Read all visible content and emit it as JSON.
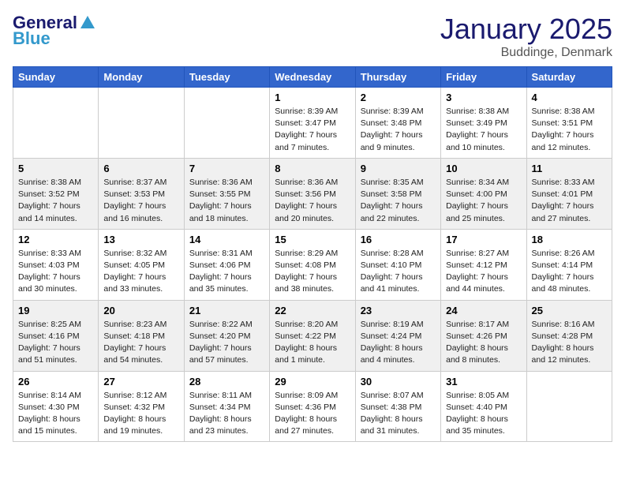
{
  "header": {
    "logo_general": "General",
    "logo_blue": "Blue",
    "month_title": "January 2025",
    "location": "Buddinge, Denmark"
  },
  "weekdays": [
    "Sunday",
    "Monday",
    "Tuesday",
    "Wednesday",
    "Thursday",
    "Friday",
    "Saturday"
  ],
  "weeks": [
    [
      {
        "day": "",
        "info": ""
      },
      {
        "day": "",
        "info": ""
      },
      {
        "day": "",
        "info": ""
      },
      {
        "day": "1",
        "info": "Sunrise: 8:39 AM\nSunset: 3:47 PM\nDaylight: 7 hours\nand 7 minutes."
      },
      {
        "day": "2",
        "info": "Sunrise: 8:39 AM\nSunset: 3:48 PM\nDaylight: 7 hours\nand 9 minutes."
      },
      {
        "day": "3",
        "info": "Sunrise: 8:38 AM\nSunset: 3:49 PM\nDaylight: 7 hours\nand 10 minutes."
      },
      {
        "day": "4",
        "info": "Sunrise: 8:38 AM\nSunset: 3:51 PM\nDaylight: 7 hours\nand 12 minutes."
      }
    ],
    [
      {
        "day": "5",
        "info": "Sunrise: 8:38 AM\nSunset: 3:52 PM\nDaylight: 7 hours\nand 14 minutes."
      },
      {
        "day": "6",
        "info": "Sunrise: 8:37 AM\nSunset: 3:53 PM\nDaylight: 7 hours\nand 16 minutes."
      },
      {
        "day": "7",
        "info": "Sunrise: 8:36 AM\nSunset: 3:55 PM\nDaylight: 7 hours\nand 18 minutes."
      },
      {
        "day": "8",
        "info": "Sunrise: 8:36 AM\nSunset: 3:56 PM\nDaylight: 7 hours\nand 20 minutes."
      },
      {
        "day": "9",
        "info": "Sunrise: 8:35 AM\nSunset: 3:58 PM\nDaylight: 7 hours\nand 22 minutes."
      },
      {
        "day": "10",
        "info": "Sunrise: 8:34 AM\nSunset: 4:00 PM\nDaylight: 7 hours\nand 25 minutes."
      },
      {
        "day": "11",
        "info": "Sunrise: 8:33 AM\nSunset: 4:01 PM\nDaylight: 7 hours\nand 27 minutes."
      }
    ],
    [
      {
        "day": "12",
        "info": "Sunrise: 8:33 AM\nSunset: 4:03 PM\nDaylight: 7 hours\nand 30 minutes."
      },
      {
        "day": "13",
        "info": "Sunrise: 8:32 AM\nSunset: 4:05 PM\nDaylight: 7 hours\nand 33 minutes."
      },
      {
        "day": "14",
        "info": "Sunrise: 8:31 AM\nSunset: 4:06 PM\nDaylight: 7 hours\nand 35 minutes."
      },
      {
        "day": "15",
        "info": "Sunrise: 8:29 AM\nSunset: 4:08 PM\nDaylight: 7 hours\nand 38 minutes."
      },
      {
        "day": "16",
        "info": "Sunrise: 8:28 AM\nSunset: 4:10 PM\nDaylight: 7 hours\nand 41 minutes."
      },
      {
        "day": "17",
        "info": "Sunrise: 8:27 AM\nSunset: 4:12 PM\nDaylight: 7 hours\nand 44 minutes."
      },
      {
        "day": "18",
        "info": "Sunrise: 8:26 AM\nSunset: 4:14 PM\nDaylight: 7 hours\nand 48 minutes."
      }
    ],
    [
      {
        "day": "19",
        "info": "Sunrise: 8:25 AM\nSunset: 4:16 PM\nDaylight: 7 hours\nand 51 minutes."
      },
      {
        "day": "20",
        "info": "Sunrise: 8:23 AM\nSunset: 4:18 PM\nDaylight: 7 hours\nand 54 minutes."
      },
      {
        "day": "21",
        "info": "Sunrise: 8:22 AM\nSunset: 4:20 PM\nDaylight: 7 hours\nand 57 minutes."
      },
      {
        "day": "22",
        "info": "Sunrise: 8:20 AM\nSunset: 4:22 PM\nDaylight: 8 hours\nand 1 minute."
      },
      {
        "day": "23",
        "info": "Sunrise: 8:19 AM\nSunset: 4:24 PM\nDaylight: 8 hours\nand 4 minutes."
      },
      {
        "day": "24",
        "info": "Sunrise: 8:17 AM\nSunset: 4:26 PM\nDaylight: 8 hours\nand 8 minutes."
      },
      {
        "day": "25",
        "info": "Sunrise: 8:16 AM\nSunset: 4:28 PM\nDaylight: 8 hours\nand 12 minutes."
      }
    ],
    [
      {
        "day": "26",
        "info": "Sunrise: 8:14 AM\nSunset: 4:30 PM\nDaylight: 8 hours\nand 15 minutes."
      },
      {
        "day": "27",
        "info": "Sunrise: 8:12 AM\nSunset: 4:32 PM\nDaylight: 8 hours\nand 19 minutes."
      },
      {
        "day": "28",
        "info": "Sunrise: 8:11 AM\nSunset: 4:34 PM\nDaylight: 8 hours\nand 23 minutes."
      },
      {
        "day": "29",
        "info": "Sunrise: 8:09 AM\nSunset: 4:36 PM\nDaylight: 8 hours\nand 27 minutes."
      },
      {
        "day": "30",
        "info": "Sunrise: 8:07 AM\nSunset: 4:38 PM\nDaylight: 8 hours\nand 31 minutes."
      },
      {
        "day": "31",
        "info": "Sunrise: 8:05 AM\nSunset: 4:40 PM\nDaylight: 8 hours\nand 35 minutes."
      },
      {
        "day": "",
        "info": ""
      }
    ]
  ]
}
